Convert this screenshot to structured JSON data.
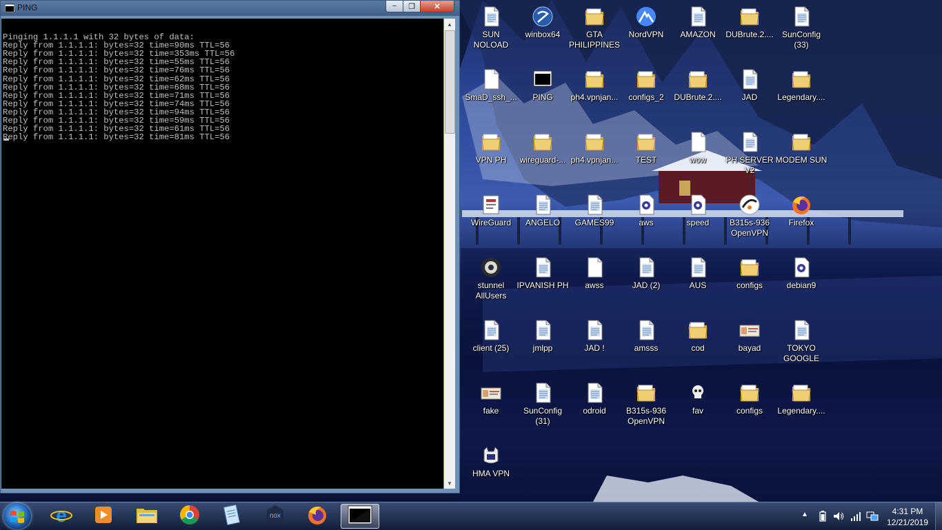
{
  "window": {
    "title": "PING",
    "console_lines": [
      "",
      "Pinging 1.1.1.1 with 32 bytes of data:",
      "Reply from 1.1.1.1: bytes=32 time=90ms TTL=56",
      "Reply from 1.1.1.1: bytes=32 time=353ms TTL=56",
      "Reply from 1.1.1.1: bytes=32 time=55ms TTL=56",
      "Reply from 1.1.1.1: bytes=32 time=76ms TTL=56",
      "Reply from 1.1.1.1: bytes=32 time=62ms TTL=56",
      "Reply from 1.1.1.1: bytes=32 time=68ms TTL=56",
      "Reply from 1.1.1.1: bytes=32 time=71ms TTL=56",
      "Reply from 1.1.1.1: bytes=32 time=74ms TTL=56",
      "Reply from 1.1.1.1: bytes=32 time=94ms TTL=56",
      "Reply from 1.1.1.1: bytes=32 time=59ms TTL=56",
      "Reply from 1.1.1.1: bytes=32 time=61ms TTL=56",
      "Reply from 1.1.1.1: bytes=32 time=81ms TTL=56"
    ]
  },
  "desktop": {
    "icons": [
      {
        "label": "SUN\nNOLOAD",
        "icon": "text-file-icon"
      },
      {
        "label": "winbox64",
        "icon": "winbox-icon"
      },
      {
        "label": "GTA\nPHILIPPINES",
        "icon": "folder-icon"
      },
      {
        "label": "NordVPN",
        "icon": "nordvpn-icon"
      },
      {
        "label": "AMAZON",
        "icon": "text-file-icon"
      },
      {
        "label": "DUBrute.2....",
        "icon": "folder-icon"
      },
      {
        "label": "SunConfig\n(33)",
        "icon": "text-file-icon"
      },
      {
        "label": "SmaD_ssh_...",
        "icon": "blank-file-icon"
      },
      {
        "label": "PING",
        "icon": "ping-shortcut-icon"
      },
      {
        "label": "ph4.vpnjan...",
        "icon": "folder-icon"
      },
      {
        "label": "configs_2",
        "icon": "folder-icon"
      },
      {
        "label": "DUBrute.2....",
        "icon": "folder-icon"
      },
      {
        "label": "JAD",
        "icon": "text-file-icon"
      },
      {
        "label": "Legendary....",
        "icon": "folder-icon"
      },
      {
        "label": "VPN PH",
        "icon": "folder-icon"
      },
      {
        "label": "wireguard-...",
        "icon": "folder-icon"
      },
      {
        "label": "ph4.vpnjan...",
        "icon": "folder-icon"
      },
      {
        "label": "TEST",
        "icon": "folder-icon"
      },
      {
        "label": "wow",
        "icon": "blank-file-icon"
      },
      {
        "label": "PH SERVER\nV2",
        "icon": "text-file-icon"
      },
      {
        "label": "MODEM SUN",
        "icon": "folder-icon"
      },
      {
        "label": "WireGuard",
        "icon": "wireguard-icon"
      },
      {
        "label": "ANGELO",
        "icon": "text-file-icon"
      },
      {
        "label": "GAMES99",
        "icon": "text-file-icon"
      },
      {
        "label": "aws",
        "icon": "config-file-icon"
      },
      {
        "label": "speed",
        "icon": "config-file-icon"
      },
      {
        "label": "B315s-936\nOpenVPN",
        "icon": "openvpn-icon"
      },
      {
        "label": "Firefox",
        "icon": "firefox-icon"
      },
      {
        "label": "stunnel\nAllUsers",
        "icon": "stunnel-icon"
      },
      {
        "label": "IPVANISH PH",
        "icon": "text-file-icon"
      },
      {
        "label": "awss",
        "icon": "blank-file-icon"
      },
      {
        "label": "JAD (2)",
        "icon": "text-file-icon"
      },
      {
        "label": "AUS",
        "icon": "text-file-icon"
      },
      {
        "label": "configs",
        "icon": "folder-icon"
      },
      {
        "label": "debian9",
        "icon": "config-file-icon"
      },
      {
        "label": "client (25)",
        "icon": "text-file-icon"
      },
      {
        "label": "jmlpp",
        "icon": "text-file-icon"
      },
      {
        "label": "JAD !",
        "icon": "text-file-icon"
      },
      {
        "label": "amsss",
        "icon": "text-file-icon"
      },
      {
        "label": "cod",
        "icon": "folder-icon"
      },
      {
        "label": "bayad",
        "icon": "image-file-icon"
      },
      {
        "label": "TOKYO\nGOOGLE",
        "icon": "text-file-icon"
      },
      {
        "label": "fake",
        "icon": "image-file-icon"
      },
      {
        "label": "SunConfig\n(31)",
        "icon": "text-file-icon"
      },
      {
        "label": "odroid",
        "icon": "text-file-icon"
      },
      {
        "label": "B315s-936\nOpenVPN",
        "icon": "folder-icon"
      },
      {
        "label": "fav",
        "icon": "skull-icon"
      },
      {
        "label": "configs",
        "icon": "folder-icon"
      },
      {
        "label": "Legendary....",
        "icon": "folder-icon"
      },
      {
        "label": "HMA VPN",
        "icon": "hma-vpn-icon"
      }
    ]
  },
  "taskbar": {
    "apps": [
      {
        "name": "internet-explorer",
        "icon": "internet-explorer-icon"
      },
      {
        "name": "media-player",
        "icon": "media-player-icon"
      },
      {
        "name": "file-explorer",
        "icon": "file-explorer-icon"
      },
      {
        "name": "chrome",
        "icon": "chrome-icon"
      },
      {
        "name": "notepad",
        "icon": "notepad-icon"
      },
      {
        "name": "nox",
        "icon": "nox-icon"
      },
      {
        "name": "firefox",
        "icon": "firefox-icon"
      },
      {
        "name": "ping-console",
        "icon": "console-icon",
        "active": true
      }
    ],
    "clock": {
      "time": "4:31 PM",
      "date": "12/21/2019"
    }
  },
  "colors": {
    "folder": "#e8c46a",
    "console_bg": "#000000",
    "console_fg": "#c0c0c0",
    "desktop_text": "#ffffff"
  }
}
